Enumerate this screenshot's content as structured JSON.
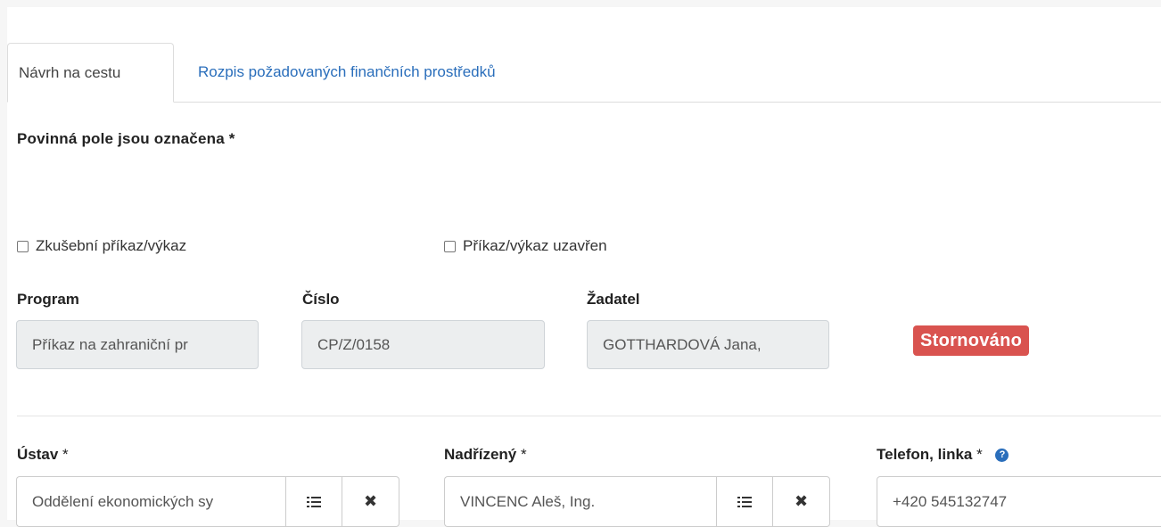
{
  "tabs": [
    {
      "label": "Návrh na cestu",
      "active": true
    },
    {
      "label": "Rozpis požadovaných finančních prostředků",
      "active": false
    }
  ],
  "required_note": "Povinná pole jsou označena",
  "required_star": "*",
  "checkboxes": [
    {
      "label": "Zkušební příkaz/výkaz",
      "checked": false
    },
    {
      "label": "Příkaz/výkaz uzavřen",
      "checked": false
    }
  ],
  "fields": {
    "program": {
      "label": "Program",
      "value": "Příkaz na zahraniční pr"
    },
    "cislo": {
      "label": "Číslo",
      "value": "CP/Z/0158"
    },
    "zadatel": {
      "label": "Žadatel",
      "value": "GOTTHARDOVÁ Jana,"
    },
    "status_badge": "Stornováno",
    "ustav": {
      "label": "Ústav",
      "star": "*",
      "value": "Oddělení ekonomických sy"
    },
    "nadrizeny": {
      "label": "Nadřízený",
      "star": "*",
      "value": "VINCENC Aleš, Ing."
    },
    "telefon": {
      "label": "Telefon, linka",
      "star": "*",
      "value": "+420 545132747"
    }
  },
  "icons": {
    "list": "list-icon",
    "clear": "times-icon",
    "help": "question-circle-icon"
  },
  "colors": {
    "link": "#2a6ebb",
    "badge_danger": "#d9534f",
    "readonly_bg": "#eceeef"
  }
}
